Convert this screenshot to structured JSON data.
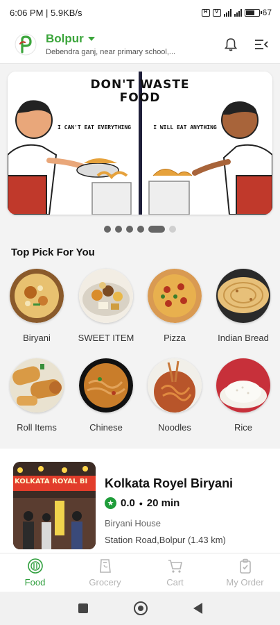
{
  "status_bar": {
    "time_speed": "6:06 PM | 5.9KB/s",
    "battery": "67"
  },
  "header": {
    "city": "Bolpur",
    "address": "Debendra ganj, near primary school,...",
    "icons": [
      "logo",
      "bell-icon",
      "menu-icon"
    ]
  },
  "banner": {
    "title_line1": "DON'T WASTE",
    "title_line2": "FOOD",
    "left_caption": "I CAN'T EAT EVERYTHING",
    "right_caption": "I WILL EAT ANYTHING"
  },
  "carousel": {
    "count": 6,
    "active_index": 4
  },
  "top_pick": {
    "title": "Top Pick For You",
    "categories": [
      {
        "label": "Biryani"
      },
      {
        "label": "SWEET ITEM"
      },
      {
        "label": "Pizza"
      },
      {
        "label": "Indian Bread"
      },
      {
        "label": "Roll Items"
      },
      {
        "label": "Chinese"
      },
      {
        "label": "Noodles"
      },
      {
        "label": "Rice"
      }
    ]
  },
  "restaurant": {
    "image_sign": "KOLKATA ROYAL BI",
    "name": "Kolkata Royel Biryani",
    "rating": "0.0",
    "time": "20 min",
    "type": "Biryani House",
    "address": "Station Road,Bolpur (1.43 km)"
  },
  "bottom_nav": {
    "items": [
      {
        "label": "Food",
        "icon": "food-icon",
        "active": true
      },
      {
        "label": "Grocery",
        "icon": "grocery-icon",
        "active": false
      },
      {
        "label": "Cart",
        "icon": "cart-icon",
        "active": false
      },
      {
        "label": "My Order",
        "icon": "order-icon",
        "active": false
      }
    ]
  },
  "colors": {
    "brand_green": "#3ba53b",
    "active_nav": "#2e9e3c",
    "rating_star": "#1f9d3a"
  }
}
